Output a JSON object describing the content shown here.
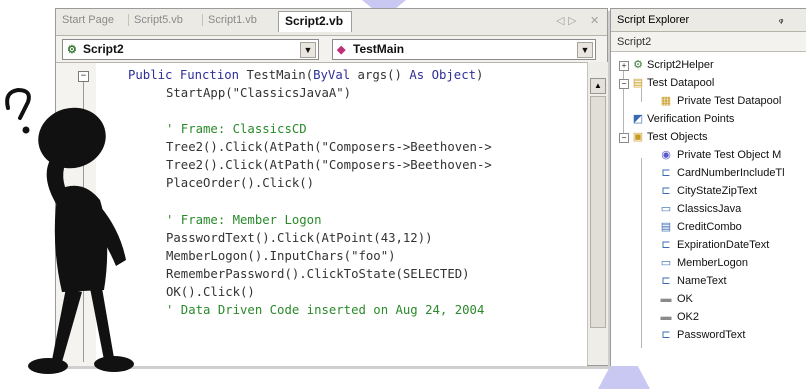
{
  "editor": {
    "tabs": [
      "Start Page",
      "Script5.vb",
      "Script1.vb"
    ],
    "active_tab": "Script2.vb",
    "class_combo": "Script2",
    "method_combo": "TestMain",
    "code_lines": {
      "l1a": "Public Function",
      "l1b": " TestMain(",
      "l1c": "ByVal",
      "l1d": " args() ",
      "l1e": "As Object",
      "l1f": ")",
      "l2": "StartApp(\"ClassicsJavaA\")",
      "l3": "' Frame: ClassicsCD",
      "l4": "Tree2().Click(AtPath(\"Composers->Beethoven->",
      "l5": "Tree2().Click(AtPath(\"Composers->Beethoven->",
      "l6": "PlaceOrder().Click()",
      "l7": "' Frame: Member Logon",
      "l8": "PasswordText().Click(AtPoint(43,12))",
      "l9": "MemberLogon().InputChars(\"foo\")",
      "l10": "RememberPassword().ClickToState(SELECTED)",
      "l11": "OK().Click()",
      "l12": "' Data Driven Code inserted on Aug 24, 2004"
    }
  },
  "explorer": {
    "title": "Script Explorer",
    "subtitle": "Script2",
    "items": {
      "helper": "Script2Helper",
      "datapool": "Test Datapool",
      "private_datapool": "Private Test Datapool",
      "vp": "Verification Points",
      "objects": "Test Objects",
      "private_obj": "Private Test Object M",
      "cardnum": "CardNumberIncludeTl",
      "citystate": "CityStateZipText",
      "classics": "ClassicsJava",
      "credit": "CreditCombo",
      "expiration": "ExpirationDateText",
      "member": "MemberLogon",
      "name": "NameText",
      "ok": "OK",
      "ok2": "OK2",
      "password": "PasswordText"
    }
  },
  "colors": {
    "keyword": "#2f2f9a",
    "comment": "#2a8a2a",
    "decor_triangle": "#c8c8f2"
  }
}
